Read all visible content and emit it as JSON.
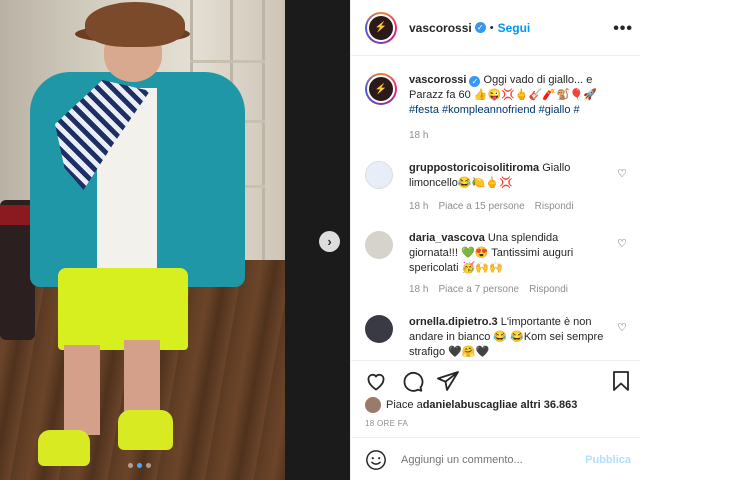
{
  "post": {
    "username": "vascorossi",
    "follow_label": "Segui",
    "more_label": "•••",
    "caption_parts": {
      "text": "Oggi vado di giallo... e Parazz fa 60 👍😜💢🖕🎸🧨🐒🎈🚀",
      "tags": "#festa #kompleannofriend #giallo #",
      "time": "18 h"
    }
  },
  "comments": [
    {
      "username": "gruppostoricoisolitiroma",
      "text": "Giallo limoncello😂🍋🖕💢",
      "time": "18 h",
      "likes": "Piace a 15 persone",
      "reply": "Rispondi"
    },
    {
      "username": "daria_vascova",
      "text": "Una splendida giornata!!! 💚😍 Tantissimi auguri spericolati 🥳🙌🙌",
      "time": "18 h",
      "likes": "Piace a 7 persone",
      "reply": "Rispondi"
    },
    {
      "username": "ornella.dipietro.3",
      "text": "L'importante è non andare in bianco 😂 😂Kom sei sempre strafigo 🖤🤗🖤"
    }
  ],
  "footer": {
    "liked_by_prefix": "Piace a ",
    "liked_by_user": "danielabuscaglia",
    "liked_by_suffix": " e altri 36.863",
    "timeago": "18 ORE FA",
    "comment_placeholder": "Aggiungi un commento...",
    "publish_label": "Pubblica"
  },
  "carousel": {
    "total": 3,
    "current": 2,
    "next_label": "›"
  },
  "icons": [
    "heart-icon",
    "comment-icon",
    "share-icon",
    "bookmark-icon",
    "emoji-icon",
    "verified-icon",
    "more-icon",
    "chevron-right-icon"
  ],
  "colors": {
    "accent": "#0095f6",
    "verified": "#3897f0",
    "muted": "#8e8e8e",
    "publish_disabled": "#b2dffc"
  }
}
